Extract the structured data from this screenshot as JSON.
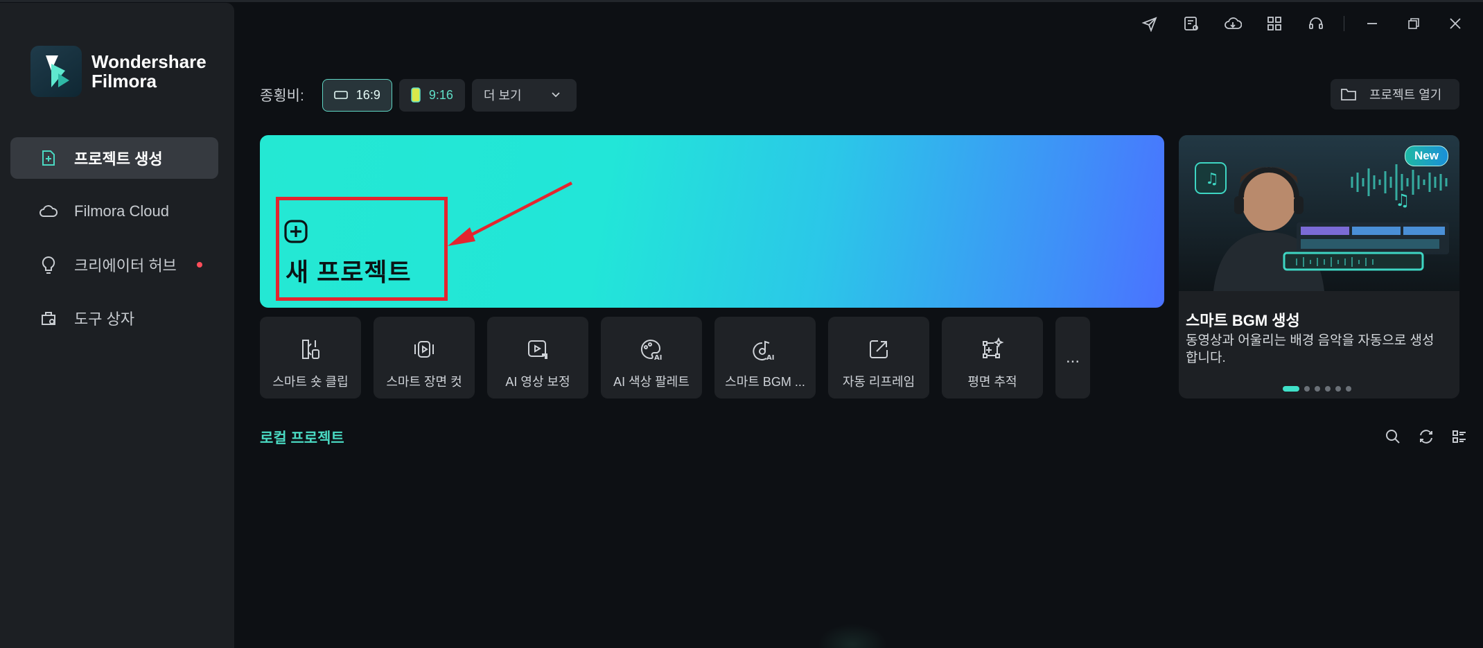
{
  "app": {
    "name_line1": "Wondershare",
    "name_line2": "Filmora"
  },
  "sidebar": {
    "items": [
      {
        "label": "프로젝트 생성",
        "icon": "new-project-icon",
        "active": true
      },
      {
        "label": "Filmora Cloud",
        "icon": "cloud-icon",
        "active": false
      },
      {
        "label": "크리에이터 허브",
        "icon": "bulb-icon",
        "active": false,
        "notification_dot": true
      },
      {
        "label": "도구 상자",
        "icon": "toolbox-icon",
        "active": false
      }
    ]
  },
  "topbar": {
    "icons": [
      "send-icon",
      "task-icon",
      "cloud-download-icon",
      "apps-grid-icon",
      "headset-icon",
      "minimize-icon",
      "restore-icon",
      "close-icon"
    ]
  },
  "aspect": {
    "label": "종횡비:",
    "options": [
      {
        "label": "16:9",
        "selected": true
      },
      {
        "label": "9:16",
        "selected": false
      },
      {
        "label": "더 보기",
        "dropdown": true
      }
    ]
  },
  "open_project": {
    "label": "프로젝트 열기",
    "icon": "folder-icon"
  },
  "hero": {
    "title": "새 프로젝트",
    "icon": "plus-square-icon"
  },
  "tools": [
    {
      "label": "스마트 숏 클립",
      "icon": "smart-short-clip-icon"
    },
    {
      "label": "스마트 장면 컷",
      "icon": "smart-scene-cut-icon"
    },
    {
      "label": "AI 영상 보정",
      "icon": "ai-video-enhance-icon"
    },
    {
      "label": "AI 색상 팔레트",
      "icon": "ai-color-palette-icon"
    },
    {
      "label": "스마트 BGM ...",
      "icon": "smart-bgm-icon"
    },
    {
      "label": "자동 리프레임",
      "icon": "auto-reframe-icon"
    },
    {
      "label": "평면 추적",
      "icon": "planar-tracking-icon"
    }
  ],
  "tools_more": "...",
  "promo": {
    "badge": "New",
    "title": "스마트 BGM 생성",
    "description": "동영상과 어울리는 배경 음악을 자동으로 생성합니다.",
    "slides": 6,
    "active_slide": 1
  },
  "local_projects": {
    "title": "로컬 프로젝트",
    "icons": [
      "search-icon",
      "refresh-icon",
      "list-view-icon"
    ]
  },
  "colors": {
    "accent": "#4ad9c2",
    "highlight_box": "#e3252f",
    "background": "#0d1014",
    "sidebar": "#1c1f23"
  }
}
